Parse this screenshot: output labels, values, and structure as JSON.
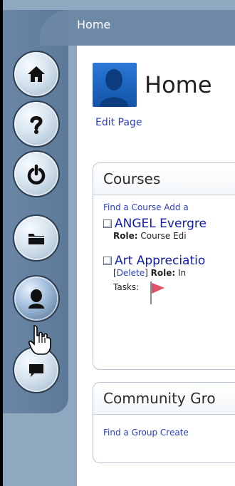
{
  "header": {
    "tab_label": "Home"
  },
  "nav": {
    "buttons": [
      {
        "name": "home",
        "icon": "home-icon"
      },
      {
        "name": "help",
        "icon": "question-icon"
      },
      {
        "name": "power",
        "icon": "power-icon"
      },
      {
        "name": "folder",
        "icon": "folder-icon"
      },
      {
        "name": "profile",
        "icon": "user-icon",
        "active": true
      },
      {
        "name": "chat",
        "icon": "chat-icon"
      }
    ]
  },
  "page": {
    "title": "Home",
    "edit_label": "Edit Page"
  },
  "courses": {
    "title": "Courses",
    "links": "Find a Course  Add a",
    "items": [
      {
        "title": "ANGEL Evergre",
        "role_label": "Role:",
        "role_value": "Course Edi"
      },
      {
        "title": "Art Appreciatio",
        "delete_open": "[",
        "delete_label": "Delete",
        "delete_close": "]",
        "role_label": "Role:",
        "role_value": "In",
        "tasks_label": "Tasks:"
      }
    ]
  },
  "community": {
    "title": "Community Gro",
    "links": "Find a Group  Create"
  },
  "colors": {
    "background": "#8fa7bf",
    "rail": "#6b87a5",
    "link": "#2b3fb8",
    "course_link": "#111ea8",
    "avatar": "#1d62c7"
  }
}
